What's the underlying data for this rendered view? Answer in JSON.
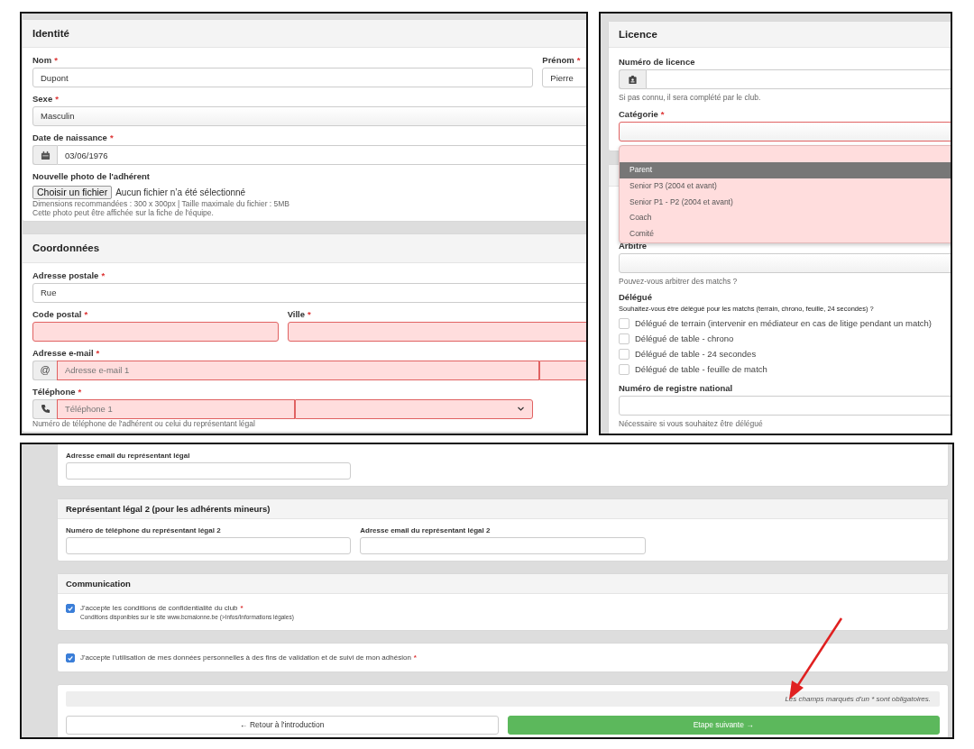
{
  "required_mark": "*",
  "left_panel": {
    "cards": [
      {
        "title": "Identité",
        "rows": [
          [
            {
              "kind": "text",
              "label": "Nom",
              "required": true,
              "value": "Dupont"
            },
            {
              "kind": "text",
              "label": "Prénom",
              "required": true,
              "value": "Pierre"
            }
          ],
          [
            {
              "kind": "select",
              "label": "Sexe",
              "required": true,
              "value": "Masculin"
            }
          ],
          [
            {
              "kind": "date",
              "label": "Date de naissance",
              "required": true,
              "value": "03/06/1976"
            }
          ],
          [
            {
              "kind": "file",
              "label": "Nouvelle photo de l'adhérent",
              "button": "Choisir un fichier",
              "status": "Aucun fichier n’a été sélectionné",
              "help": [
                "Dimensions recommandées : 300 x 300px | Taille maximale du fichier : 5MB",
                "Cette photo peut être affichée sur la fiche de l'équipe."
              ]
            }
          ]
        ]
      },
      {
        "title": "Coordonnées",
        "rows": [
          [
            {
              "kind": "text",
              "label": "Adresse postale",
              "required": true,
              "value": "Rue"
            }
          ],
          [
            {
              "kind": "text",
              "label": "Code postal",
              "required": true,
              "invalid": true
            },
            {
              "kind": "text",
              "label": "Ville",
              "required": true,
              "invalid": true
            }
          ],
          [
            {
              "kind": "email",
              "label": "Adresse e-mail",
              "required": true,
              "prefix": "@",
              "placeholder": "Adresse e-mail 1",
              "invalid": true
            }
          ],
          [
            {
              "kind": "phone",
              "label": "Téléphone",
              "required": true,
              "placeholder": "Téléphone 1",
              "invalid": true,
              "help": [
                "Numéro de téléphone de l'adhérent ou celui du représentant légal"
              ]
            }
          ]
        ]
      }
    ]
  },
  "right_panel": {
    "cards": [
      {
        "title": "Licence",
        "rows": [
          [
            {
              "kind": "licence",
              "label": "Numéro de licence",
              "help": [
                "Si pas connu, il sera complété par le club."
              ]
            }
          ],
          [
            {
              "kind": "select",
              "label": "Catégorie",
              "required": true,
              "invalid": true,
              "expanded": true,
              "options": [
                {
                  "label": "Parent",
                  "selected": true
                },
                {
                  "label": "Senior P3 (2004 et avant)",
                  "selected": false
                },
                {
                  "label": "Senior P1 - P2 (2004 et avant)",
                  "selected": false
                },
                {
                  "label": "Coach",
                  "selected": false
                },
                {
                  "label": "Comité",
                  "selected": false
                }
              ]
            }
          ]
        ]
      },
      {
        "rows": [
          [
            {
              "kind": "select",
              "label": "Arbitre",
              "help": [
                "Pouvez-vous arbitrer des matchs ?"
              ]
            }
          ],
          [
            {
              "kind": "checklist",
              "label": "Délégué",
              "subtitle": "Souhaitez-vous être délégué pour les matchs (terrain, chrono, feuille, 24 secondes) ?",
              "items": [
                {
                  "label": "Délégué de terrain (intervenir en médiateur en cas de litige pendant un match)",
                  "checked": false
                },
                {
                  "label": "Délégué de table - chrono",
                  "checked": false
                },
                {
                  "label": "Délégué de table - 24 secondes",
                  "checked": false
                },
                {
                  "label": "Délégué de table - feuille de match",
                  "checked": false
                }
              ]
            }
          ],
          [
            {
              "kind": "text",
              "label": "Numéro de registre national",
              "help": [
                "Nécessaire si vous souhaitez être délégué"
              ]
            }
          ]
        ]
      }
    ]
  },
  "bottom_panel": {
    "cards": [
      {
        "rows": [
          [
            {
              "kind": "text",
              "label": "Adresse email du représentant légal"
            }
          ]
        ]
      },
      {
        "title": "Représentant légal 2 (pour les adhérents mineurs)",
        "rows": [
          [
            {
              "kind": "text",
              "label": "Numéro de téléphone du représentant légal 2"
            },
            {
              "kind": "text",
              "label": "Adresse email du représentant légal 2"
            }
          ]
        ]
      },
      {
        "title": "Communication",
        "rows": [
          [
            {
              "kind": "checkbox",
              "label": "J'accepte les conditions de confidentialité du club",
              "required": true,
              "checked": true,
              "note": "Conditions disponibles sur le site www.bcmalonne.be (>Infos/Informations légales)"
            }
          ]
        ]
      },
      {
        "rows": [
          [
            {
              "kind": "checkbox",
              "label": "J'accepte l'utilisation de mes données personnelles à des fins de validation et de suivi de mon adhésion",
              "required": true,
              "checked": true
            }
          ]
        ]
      }
    ],
    "footer": {
      "note": "Les champs marqués d'un * sont obligatoires.",
      "back_button": "← Retour à l'introduction",
      "next_button": "Etape suivante →"
    }
  }
}
